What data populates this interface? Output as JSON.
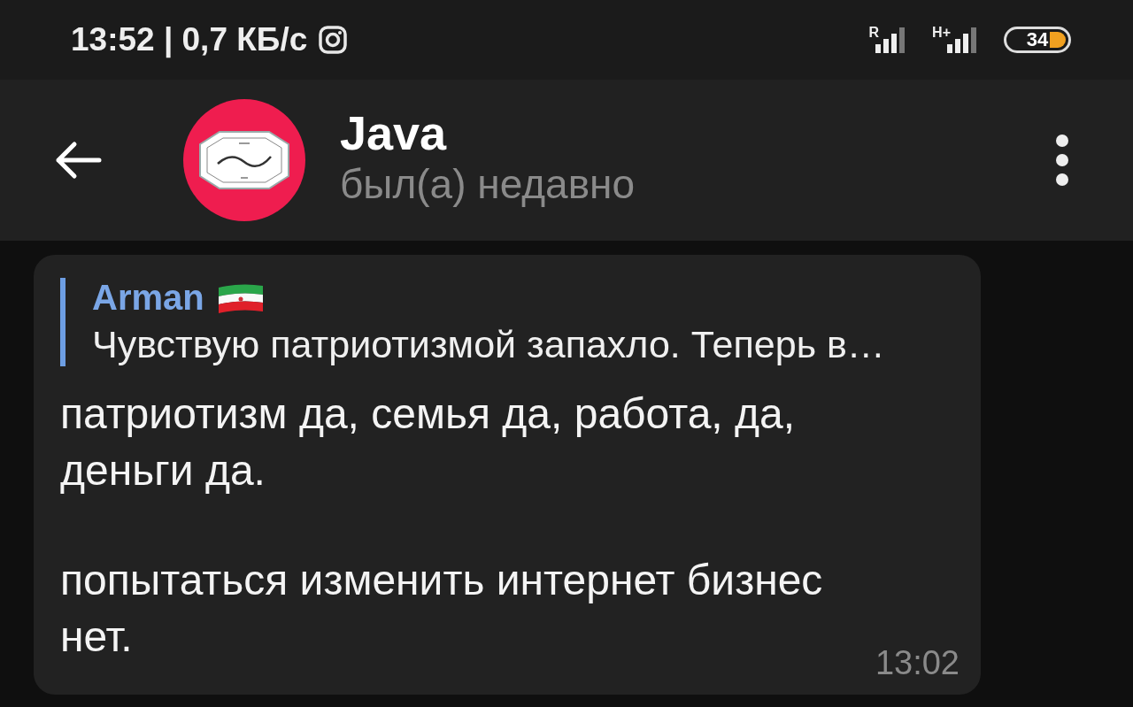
{
  "status_bar": {
    "time": "13:52",
    "separator": "|",
    "speed": "0,7 КБ/с",
    "signals": [
      {
        "label": "R"
      },
      {
        "label": "H+"
      }
    ],
    "battery": "34"
  },
  "header": {
    "title": "Java",
    "subtitle": "был(а) недавно"
  },
  "message": {
    "reply": {
      "author": "Arman",
      "text": "Чувствую патриотизмой запахло. Теперь в…"
    },
    "paragraphs": [
      "патриотизм да, семья да, работа, да, деньги да.",
      "попытаться изменить интернет бизнес нет."
    ],
    "time": "13:02"
  }
}
